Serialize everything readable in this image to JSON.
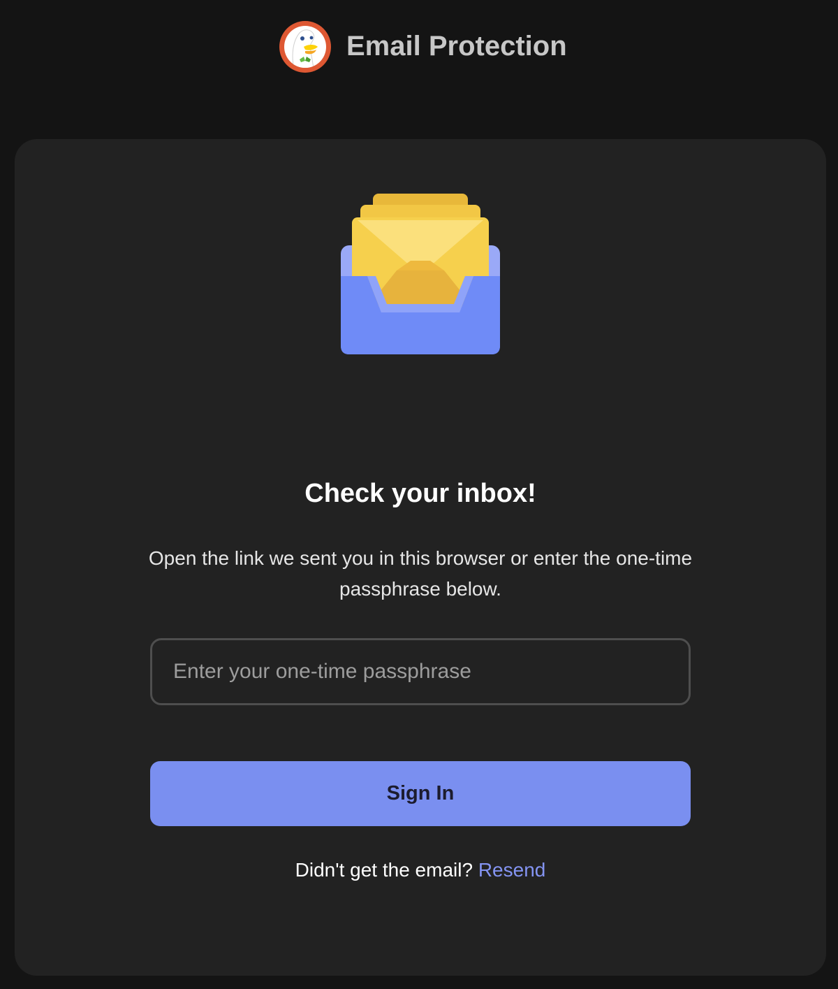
{
  "header": {
    "logo_icon": "duckduckgo-logo-icon",
    "title": "Email Protection"
  },
  "card": {
    "illustration_icon": "inbox-envelopes-icon",
    "title": "Check your inbox!",
    "description": "Open the link we sent you in this browser or enter the one-time passphrase below.",
    "passphrase": {
      "value": "",
      "placeholder": "Enter your one-time passphrase"
    },
    "sign_in_label": "Sign In",
    "resend_prompt": "Didn't get the email?",
    "resend_link": "Resend"
  },
  "colors": {
    "page_background": "#141414",
    "card_background": "#222222",
    "primary_button": "#7a8ff0",
    "link": "#8494f2",
    "input_border": "#4e4e4e"
  }
}
